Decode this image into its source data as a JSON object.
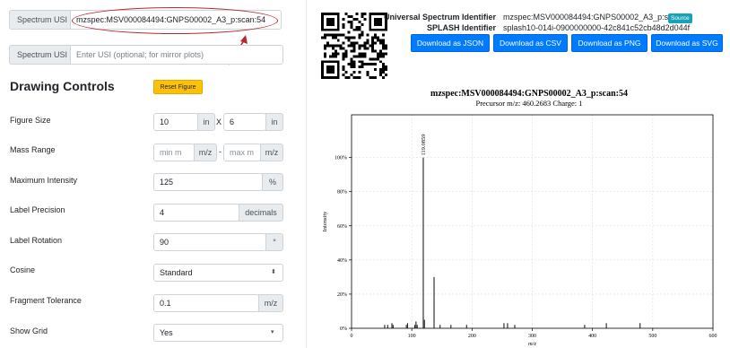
{
  "usi_field": {
    "label": "Spectrum USI",
    "value": "mzspec:MSV000084494:GNPS00002_A3_p:scan:54"
  },
  "mirror_field": {
    "label": "Spectrum USI",
    "placeholder": "Enter USI (optional; for mirror plots)"
  },
  "controls": {
    "heading": "Drawing Controls",
    "reset_label": "Reset Figure",
    "figure_size": {
      "label": "Figure Size",
      "width": "10",
      "width_unit": "in",
      "separator": "X",
      "height": "6",
      "height_unit": "in"
    },
    "mass_range": {
      "label": "Mass Range",
      "min_placeholder": "min m",
      "min_unit": "m/z",
      "separator": "-",
      "max_placeholder": "max m",
      "max_unit": "m/z"
    },
    "max_intensity": {
      "label": "Maximum Intensity",
      "value": "125",
      "unit": "%"
    },
    "label_precision": {
      "label": "Label Precision",
      "value": "4",
      "unit": "decimals"
    },
    "label_rotation": {
      "label": "Label Rotation",
      "value": "90",
      "unit": "°"
    },
    "cosine": {
      "label": "Cosine",
      "value": "Standard"
    },
    "fragment_tolerance": {
      "label": "Fragment Tolerance",
      "value": "0.1",
      "unit": "m/z"
    },
    "show_grid": {
      "label": "Show Grid",
      "value": "Yes"
    }
  },
  "identifiers": {
    "usi_label": "Universal Spectrum Identifier",
    "usi_value": "mzspec:MSV000084494:GNPS00002_A3_p:scan:54",
    "source_badge": "Source",
    "splash_label": "SPLASH Identifier",
    "splash_value": "splash10-014i-0900000000-42c841c52cb48d2d044f"
  },
  "downloads": [
    "Download as JSON",
    "Download as CSV",
    "Download as PNG",
    "Download as SVG"
  ],
  "colors": {
    "primary": "#007bff",
    "warning": "#ffc107",
    "info": "#17a2b8",
    "annotation": "#b8292f"
  },
  "plot": {
    "title": "mzspec:MSV000084494:GNPS00002_A3_p:scan:54",
    "subtitle": "Precursor m/z: 460.2683 Charge: 1",
    "peak_label": "119.0859"
  },
  "chart_data": {
    "type": "bar",
    "title": "mzspec:MSV000084494:GNPS00002_A3_p:scan:54",
    "subtitle": "Precursor m/z: 460.2683 Charge: 1",
    "xlabel": "m/z",
    "ylabel": "Intensity",
    "xlim": [
      0,
      600
    ],
    "ylim": [
      0,
      125
    ],
    "xticks": [
      "0",
      "100",
      "200",
      "300",
      "400",
      "500",
      "600"
    ],
    "yticks": [
      "0%",
      "20%",
      "40%",
      "60%",
      "80%",
      "100%"
    ],
    "grid": true,
    "peaks": [
      {
        "mz": 55,
        "intensity": 2
      },
      {
        "mz": 60,
        "intensity": 2
      },
      {
        "mz": 67,
        "intensity": 3
      },
      {
        "mz": 69,
        "intensity": 2
      },
      {
        "mz": 91,
        "intensity": 2
      },
      {
        "mz": 93,
        "intensity": 3
      },
      {
        "mz": 105,
        "intensity": 2
      },
      {
        "mz": 107,
        "intensity": 4
      },
      {
        "mz": 109,
        "intensity": 2
      },
      {
        "mz": 119.0859,
        "intensity": 100
      },
      {
        "mz": 121,
        "intensity": 5
      },
      {
        "mz": 137,
        "intensity": 30
      },
      {
        "mz": 147,
        "intensity": 2
      },
      {
        "mz": 165,
        "intensity": 2
      },
      {
        "mz": 191,
        "intensity": 2
      },
      {
        "mz": 253,
        "intensity": 3
      },
      {
        "mz": 259,
        "intensity": 3
      },
      {
        "mz": 271,
        "intensity": 2
      },
      {
        "mz": 387,
        "intensity": 2
      },
      {
        "mz": 423,
        "intensity": 3
      },
      {
        "mz": 479,
        "intensity": 3
      }
    ],
    "annotations": [
      {
        "mz": 119.0859,
        "label": "119.0859"
      }
    ]
  }
}
